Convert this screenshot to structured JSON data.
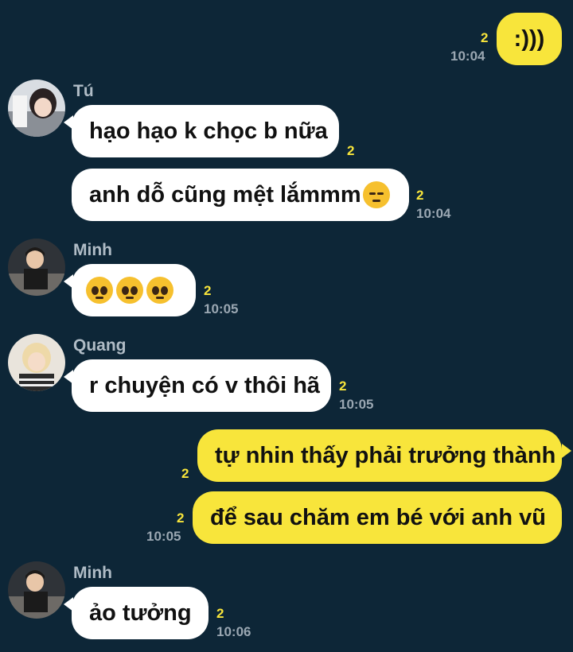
{
  "colors": {
    "background": "#0d2637",
    "incoming_bubble": "#ffffff",
    "outgoing_bubble": "#f8e53b",
    "read_count": "#f8e53b",
    "timestamp": "#9aa7b2"
  },
  "messages": [
    {
      "sender": "",
      "text": ":)))",
      "read": "2",
      "time": "10:04"
    },
    {
      "sender": "Tú",
      "text": "hạo hạo k chọc b nữa",
      "read": "2",
      "time": ""
    },
    {
      "sender": "",
      "text": "anh dỗ cũng mệt lắmmm",
      "emoji": "pensive-face-emoji",
      "read": "2",
      "time": "10:04"
    },
    {
      "sender": "Minh",
      "text": "",
      "emoji": "pleading-face-emoji",
      "read": "2",
      "time": "10:05"
    },
    {
      "sender": "Quang",
      "text": "r chuyện có v thôi hã",
      "read": "2",
      "time": "10:05"
    },
    {
      "sender": "",
      "text": "tự nhin thấy phải trưởng thành",
      "read": "2",
      "time": ""
    },
    {
      "sender": "",
      "text": "để sau chăm em bé với anh vũ",
      "read": "2",
      "time": "10:05"
    },
    {
      "sender": "Minh",
      "text": "ảo tưởng",
      "read": "2",
      "time": "10:06"
    }
  ]
}
